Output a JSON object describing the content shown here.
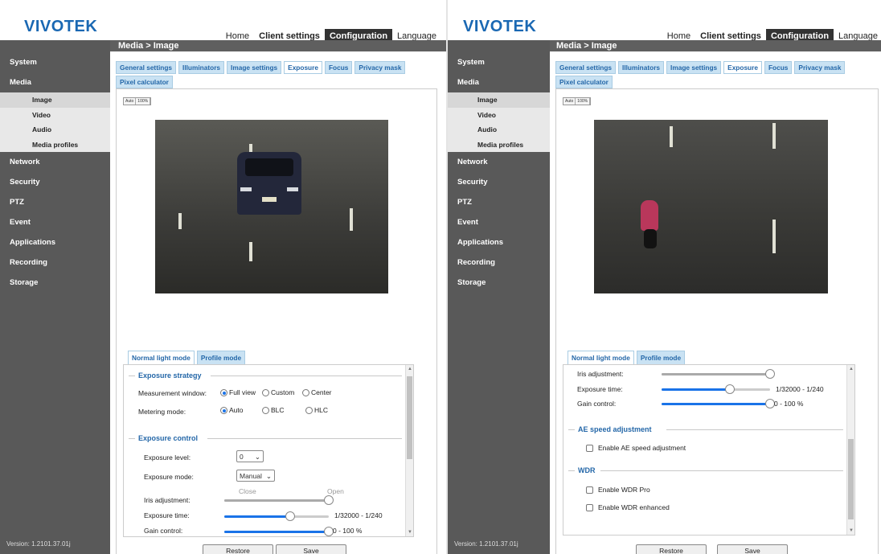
{
  "app": {
    "logo": "VIVOTEK",
    "topnav": [
      "Home",
      "Client settings",
      "Configuration",
      "Language"
    ],
    "active_nav": "Configuration",
    "breadcrumb": "Media > Image",
    "version": "Version: 1.2101.37.01j"
  },
  "sidebar": {
    "items": [
      "System",
      "Media",
      "Network",
      "Security",
      "PTZ",
      "Event",
      "Applications",
      "Recording",
      "Storage"
    ],
    "media_sub": [
      "Image",
      "Video",
      "Audio",
      "Media profiles"
    ],
    "selected_sub": "Image"
  },
  "tabs": [
    "General settings",
    "Illuminators",
    "Image settings",
    "Exposure",
    "Focus",
    "Privacy mask",
    "Pixel calculator"
  ],
  "active_tab": "Exposure",
  "view_buttons": [
    "Auto",
    "100%"
  ],
  "mode_tabs": [
    "Normal light mode",
    "Profile mode"
  ],
  "left": {
    "exposure_strategy": "Exposure strategy",
    "measurement_label": "Measurement window:",
    "measurement_options": [
      "Full view",
      "Custom",
      "Center"
    ],
    "metering_label": "Metering mode:",
    "metering_options": [
      "Auto",
      "BLC",
      "HLC"
    ],
    "exposure_control": "Exposure control",
    "level_label": "Exposure level:",
    "level_value": "0",
    "mode_label": "Exposure mode:",
    "mode_value": "Manual",
    "iris_label": "Iris adjustment:",
    "iris_close": "Close",
    "iris_open": "Open",
    "exposure_time_label": "Exposure time:",
    "exposure_time_value": "1/32000 - 1/240",
    "gain_label": "Gain control:",
    "gain_value": "0 - 100 %"
  },
  "right": {
    "iris_label": "Iris adjustment:",
    "exposure_time_label": "Exposure time:",
    "exposure_time_value": "1/32000 - 1/240",
    "gain_label": "Gain control:",
    "gain_value": "0 - 100 %",
    "ae_section": "AE speed adjustment",
    "ae_checkbox": "Enable AE speed adjustment",
    "wdr_section": "WDR",
    "wdr_pro": "Enable WDR Pro",
    "wdr_enhanced": "Enable WDR enhanced"
  },
  "buttons": {
    "restore": "Restore",
    "save": "Save"
  },
  "levels": {
    "iris_open_fraction": 1.0,
    "exposure_time_fraction": 0.63,
    "gain_fraction": 1.0
  }
}
